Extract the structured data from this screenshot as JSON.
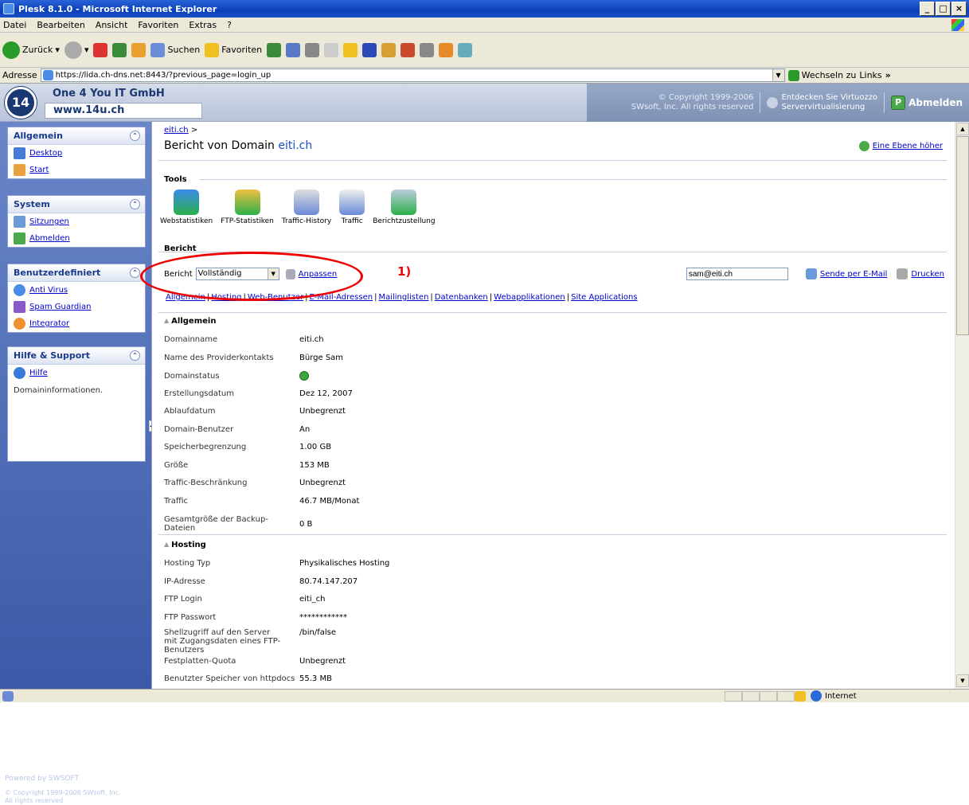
{
  "window": {
    "title": "Plesk 8.1.0 - Microsoft Internet Explorer",
    "min": "_",
    "max": "□",
    "close": "×"
  },
  "menu": [
    "Datei",
    "Bearbeiten",
    "Ansicht",
    "Favoriten",
    "Extras",
    "?"
  ],
  "toolbar": {
    "back": "Zurück",
    "search": "Suchen",
    "favorites": "Favoriten"
  },
  "address": {
    "label": "Adresse",
    "url": "https://lida.ch-dns.net:8443/?previous_page=login_up",
    "go": "Wechseln zu",
    "links": "Links"
  },
  "header": {
    "company": "One 4 You IT GmbH",
    "web": "www.14u.ch",
    "copyright_l1": "© Copyright 1999-2006",
    "copyright_l2": "SWsoft, Inc. All rights reserved",
    "virt_l1": "Entdecken Sie Virtuozzo",
    "virt_l2": "Servervirtualisierung",
    "logout": "Abmelden"
  },
  "sidebar": {
    "allgemein": {
      "title": "Allgemein",
      "items": [
        "Desktop",
        "Start"
      ]
    },
    "system": {
      "title": "System",
      "items": [
        "Sitzungen",
        "Abmelden"
      ]
    },
    "benutzer": {
      "title": "Benutzerdefiniert",
      "items": [
        "Anti Virus",
        "Spam Guardian",
        "Integrator"
      ]
    },
    "hilfe": {
      "title": "Hilfe & Support",
      "items": [
        "Hilfe"
      ],
      "desc": "Domaininformationen."
    },
    "powered": "Powered by SWSOFT",
    "copy_l1": "© Copyright 1999-2006 SWsoft, Inc.",
    "copy_l2": "All rights reserved"
  },
  "main": {
    "crumb": "eiti.ch",
    "crumb_sep": ">",
    "title_prefix": "Bericht von Domain",
    "title_domain": "eiti.ch",
    "up_level": "Eine Ebene höher",
    "tools_label": "Tools",
    "tools": [
      "Webstatistiken",
      "FTP-Statistiken",
      "Traffic-History",
      "Traffic",
      "Berichtzustellung"
    ],
    "bericht_label": "Bericht",
    "bericht_select_label": "Bericht",
    "bericht_select_value": "Vollständig",
    "anpassen": "Anpassen",
    "annotation": "1)",
    "email_value": "sam@eiti.ch",
    "send_email": "Sende per E-Mail",
    "print": "Drucken",
    "links": [
      "Allgemein",
      "Hosting",
      "Web-Benutzer",
      "E-Mail-Adressen",
      "Mailinglisten",
      "Datenbanken",
      "Webapplikationen",
      "Site Applications"
    ],
    "allgemein_title": "Allgemein",
    "allgemein_rows": [
      {
        "k": "Domainname",
        "v": "eiti.ch"
      },
      {
        "k": "Name des Providerkontakts",
        "v": "Bürge Sam"
      },
      {
        "k": "Domainstatus",
        "v": ""
      },
      {
        "k": "Erstellungsdatum",
        "v": "Dez 12, 2007"
      },
      {
        "k": "Ablaufdatum",
        "v": "Unbegrenzt"
      },
      {
        "k": "Domain-Benutzer",
        "v": "An"
      },
      {
        "k": "Speicherbegrenzung",
        "v": "1.00 GB"
      },
      {
        "k": "Größe",
        "v": "153 MB"
      },
      {
        "k": "Traffic-Beschränkung",
        "v": "Unbegrenzt"
      },
      {
        "k": "Traffic",
        "v": "46.7 MB/Monat"
      },
      {
        "k": "Gesamtgröße der Backup-Dateien",
        "v": "0 B"
      }
    ],
    "hosting_title": "Hosting",
    "hosting_rows": [
      {
        "k": "Hosting Typ",
        "v": "Physikalisches Hosting"
      },
      {
        "k": "IP-Adresse",
        "v": "80.74.147.207"
      },
      {
        "k": "FTP Login",
        "v": "eiti_ch"
      },
      {
        "k": "FTP Passwort",
        "v": "************"
      },
      {
        "k": "Shellzugriff auf den Server mit Zugangsdaten eines FTP-Benutzers",
        "v": "/bin/false"
      },
      {
        "k": "Festplatten-Quota",
        "v": "Unbegrenzt"
      },
      {
        "k": "Benutzter Speicher von httpdocs",
        "v": "55.3 MB"
      }
    ]
  },
  "status": {
    "zone": "Internet"
  }
}
